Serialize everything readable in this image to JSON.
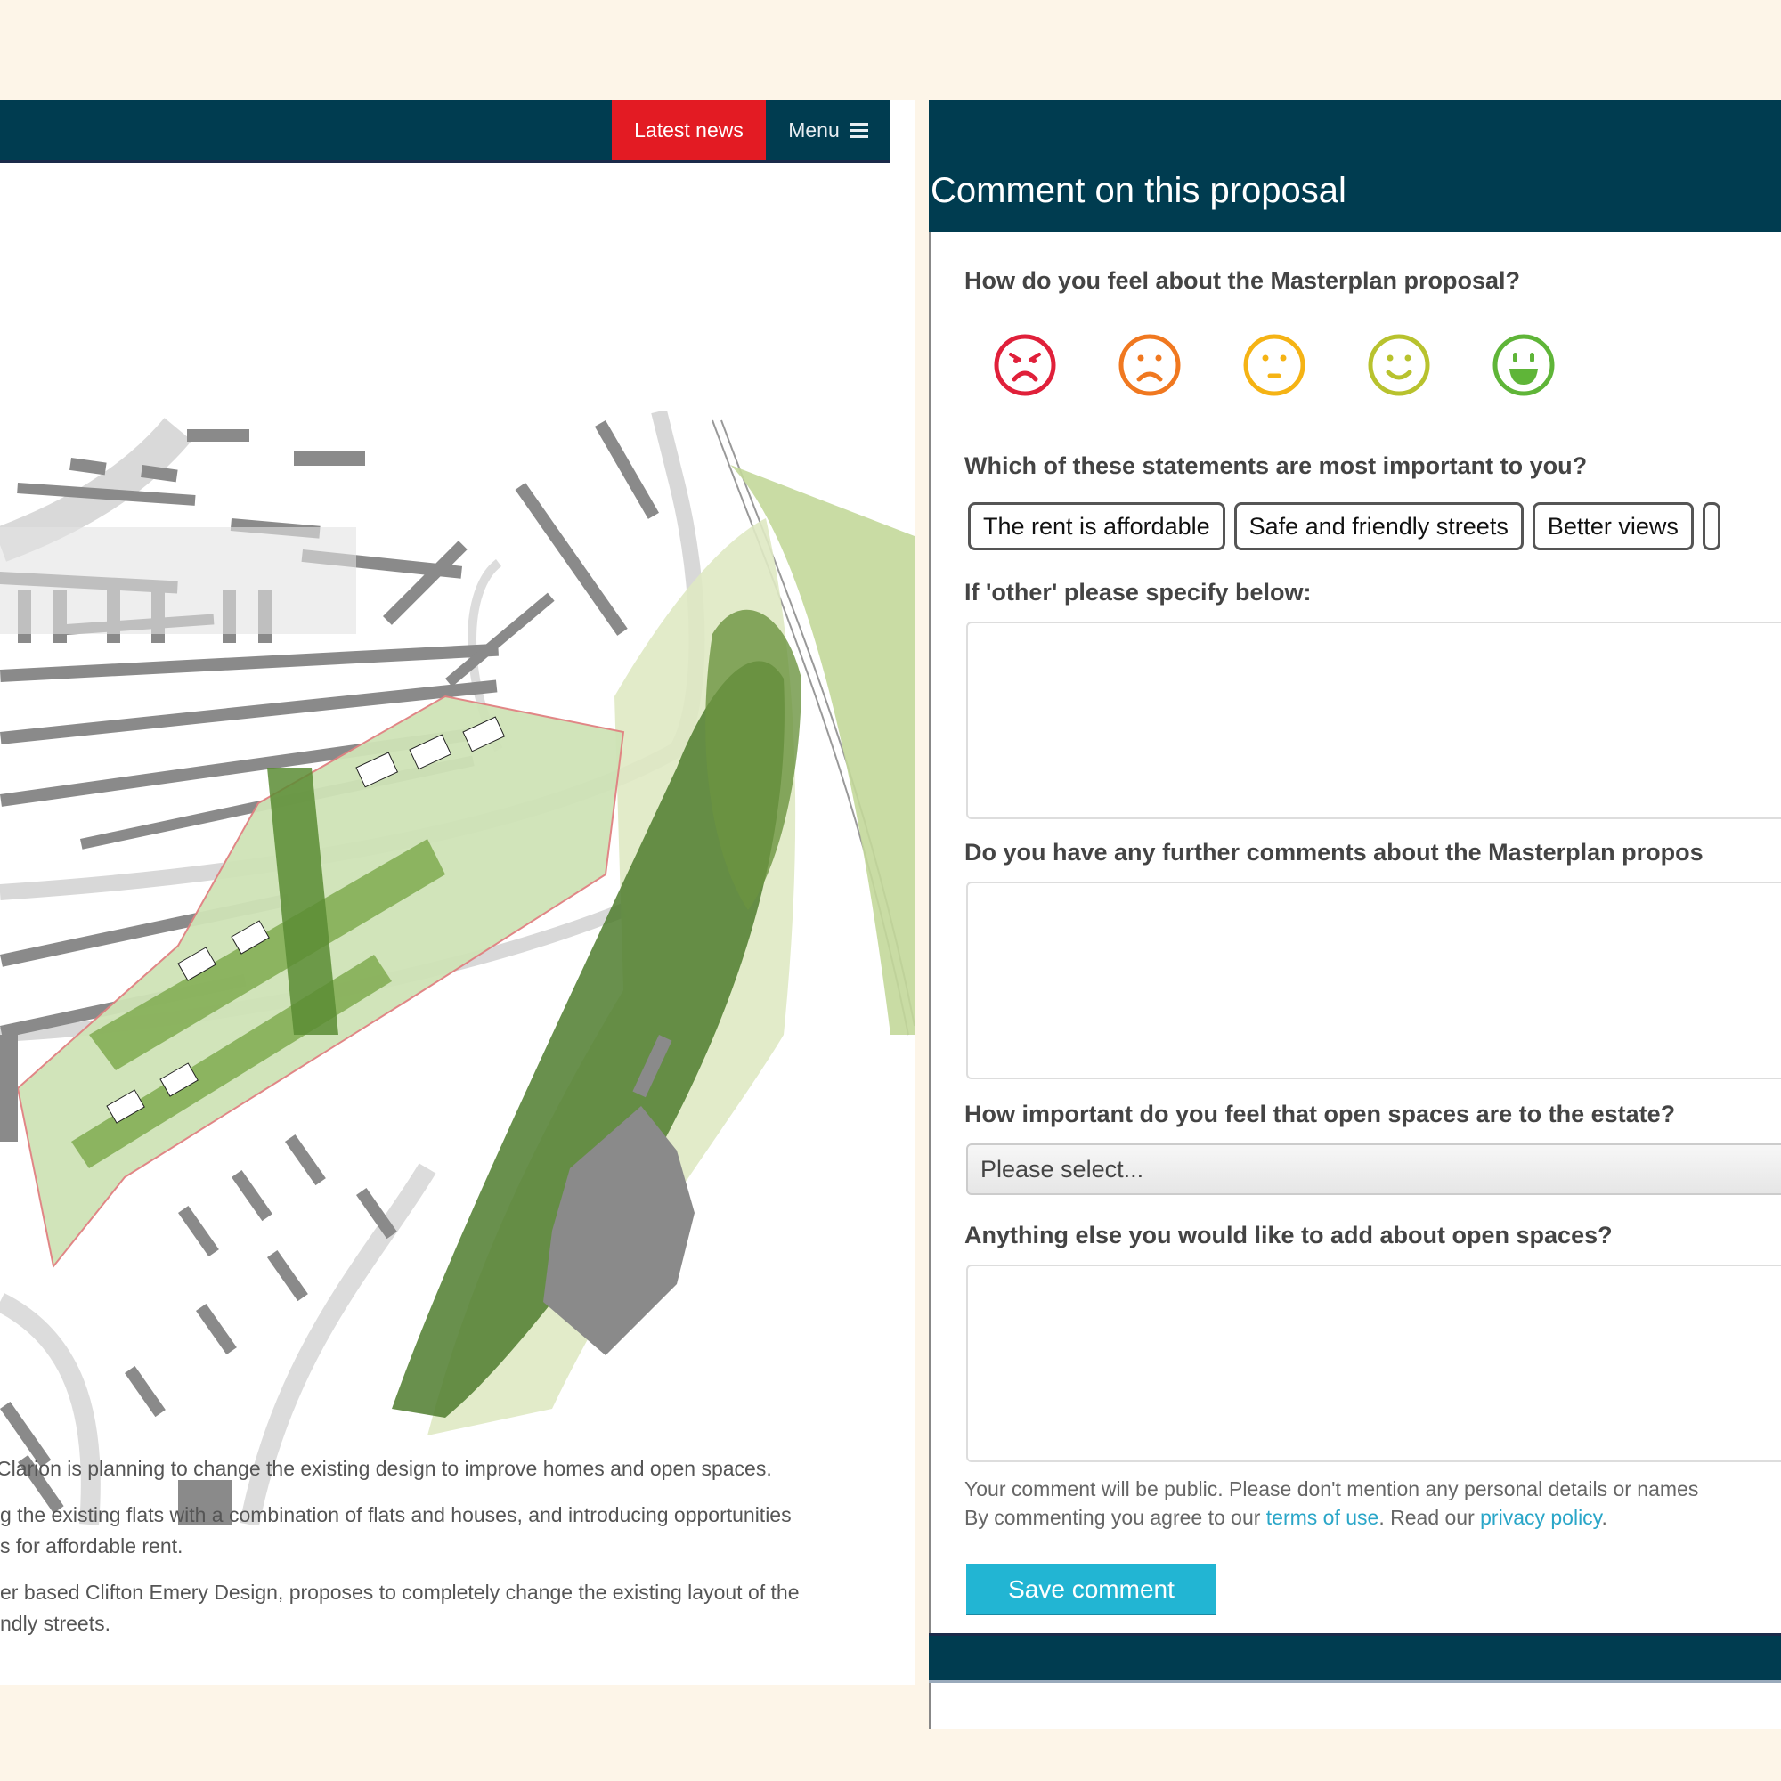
{
  "colors": {
    "page_bg": "#fdf5e8",
    "header_bg": "#003c50",
    "latest_news_bg": "#e31b23",
    "button_accent": "#22b5d3",
    "link": "#2aa6c8"
  },
  "left": {
    "nav": {
      "latest_news": "Latest news",
      "menu": "Menu",
      "menu_icon": "hamburger-icon"
    },
    "map": {
      "description": "Masterplan site plan illustration",
      "icon": "site-plan-image"
    },
    "article": {
      "paragraphs": [
        "Clarion is planning to change the existing design to improve homes and open spaces.",
        "g the existing flats with a combination of flats and houses, and introducing opportunities",
        "s for affordable rent.",
        "er based Clifton Emery Design, proposes to completely change the existing layout of the",
        "ndly streets."
      ]
    }
  },
  "form": {
    "title": "Comment on this proposal",
    "q1": {
      "label": "How do you feel about the Masterplan proposal?",
      "faces": [
        {
          "name": "very-unhappy",
          "color": "#e0203a"
        },
        {
          "name": "unhappy",
          "color": "#f07820"
        },
        {
          "name": "neutral",
          "color": "#f5b314"
        },
        {
          "name": "happy",
          "color": "#b8c22e"
        },
        {
          "name": "very-happy",
          "color": "#5fb538"
        }
      ]
    },
    "q2": {
      "label": "Which of these statements are most important to you?",
      "options": [
        "The rent is affordable",
        "Safe and friendly streets",
        "Better views"
      ]
    },
    "q3": {
      "label": "If 'other' please specify below:",
      "value": ""
    },
    "q4": {
      "label": "Do you have any further comments about the Masterplan propos",
      "value": ""
    },
    "q5": {
      "label": "How important do you feel that open spaces are to the estate?",
      "selected": "Please select..."
    },
    "q6": {
      "label": "Anything else you would like to add about open spaces?",
      "value": ""
    },
    "notice": {
      "line1": "Your comment will be public. Please don't mention any personal details or names",
      "line2_prefix": "By commenting you agree to our ",
      "terms_link": "terms of use",
      "line2_middle": ". Read our ",
      "privacy_link": "privacy policy",
      "line2_suffix": "."
    },
    "save_button": "Save comment"
  }
}
